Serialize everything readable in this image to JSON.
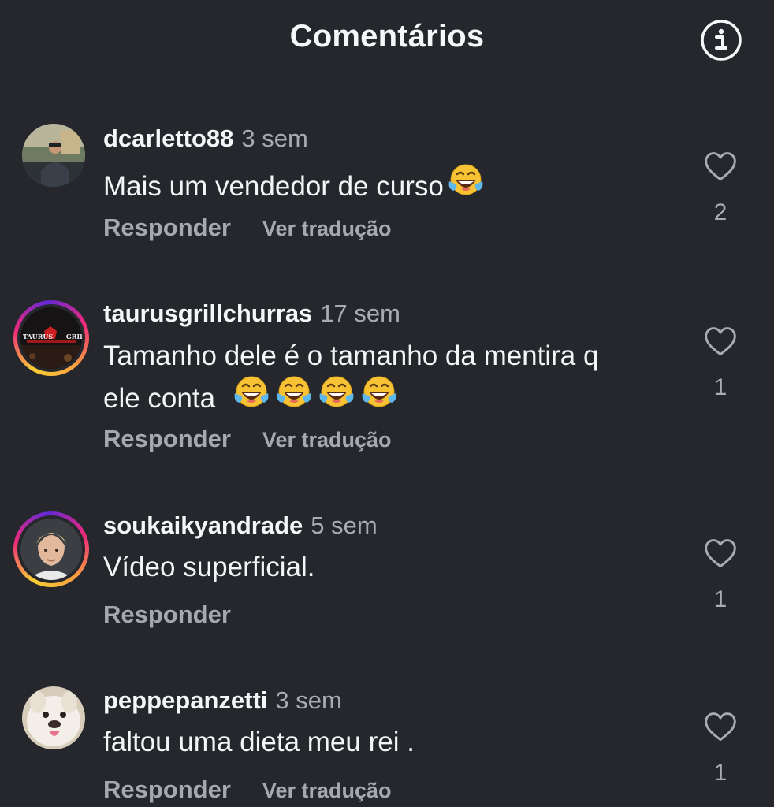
{
  "header": {
    "title": "Comentários",
    "info_icon": "info-circle-icon"
  },
  "comments": [
    {
      "username": "dcarletto88",
      "time": "3 sem",
      "text": "Mais um vendedor de curso",
      "emoji_count": 1,
      "reply_label": "Responder",
      "translate_label": "Ver tradução",
      "likes": "2",
      "story_ring": false
    },
    {
      "username": "taurusgrillchurras",
      "time": "17 sem",
      "text_line1": "Tamanho dele é o tamanho da mentira q",
      "text_line2": "ele conta",
      "emoji_count": 4,
      "reply_label": "Responder",
      "translate_label": "Ver tradução",
      "likes": "1",
      "story_ring": true,
      "avatar_logo_left": "TAURUS",
      "avatar_logo_right": "GRILL"
    },
    {
      "username": "soukaikyandrade",
      "time": "5 sem",
      "text": "Vídeo superficial.",
      "reply_label": "Responder",
      "likes": "1",
      "story_ring": true
    },
    {
      "username": "peppepanzetti",
      "time": "3 sem",
      "text": "faltou uma dieta meu rei .",
      "reply_label": "Responder",
      "translate_label": "Ver tradução",
      "likes": "1",
      "story_ring": false
    }
  ],
  "icons": {
    "like": "heart-outline-icon",
    "emoji": "face-with-tears-of-joy-icon"
  },
  "colors": {
    "background": "#25272c",
    "primary_text": "#f4f5f6",
    "secondary_text": "#a8abb2",
    "story_ring": [
      "#f9ce34",
      "#ee2a7b",
      "#6228d7"
    ]
  }
}
